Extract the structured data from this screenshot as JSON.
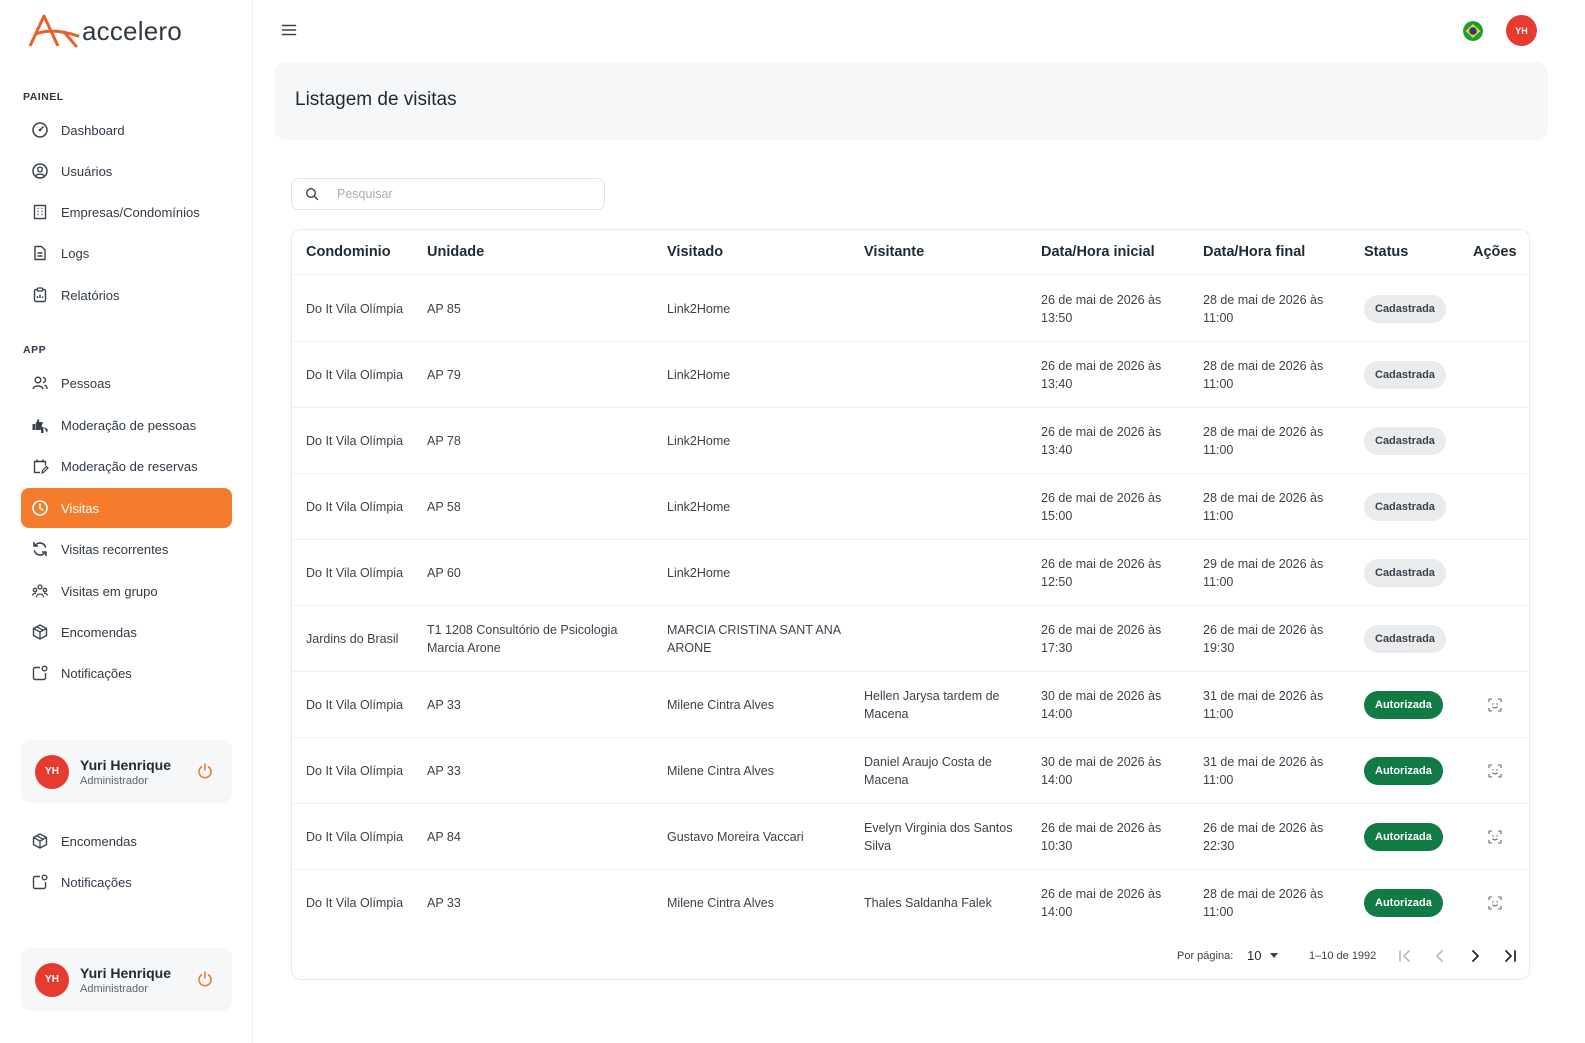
{
  "brand": {
    "name": "accelero",
    "accent": "#f47c2c"
  },
  "sidebar": {
    "sections": [
      {
        "label": "PAINEL",
        "items": [
          {
            "label": "Dashboard",
            "icon": "dashboard-icon"
          },
          {
            "label": "Usuários",
            "icon": "user-circle-icon"
          },
          {
            "label": "Empresas/Condomínios",
            "icon": "building-icon"
          },
          {
            "label": "Logs",
            "icon": "file-icon"
          },
          {
            "label": "Relatórios",
            "icon": "clipboard-icon"
          }
        ]
      },
      {
        "label": "APP",
        "items": [
          {
            "label": "Pessoas",
            "icon": "people-icon"
          },
          {
            "label": "Moderação de pessoas",
            "icon": "thumbs-icon"
          },
          {
            "label": "Moderação de reservas",
            "icon": "calendar-edit-icon"
          },
          {
            "label": "Visitas",
            "icon": "clock-icon",
            "active": true
          },
          {
            "label": "Visitas recorrentes",
            "icon": "refresh-icon"
          },
          {
            "label": "Visitas em grupo",
            "icon": "group-icon"
          },
          {
            "label": "Encomendas",
            "icon": "package-icon"
          },
          {
            "label": "Notificações",
            "icon": "notification-icon"
          }
        ]
      }
    ],
    "extra_items": [
      {
        "label": "Encomendas",
        "icon": "package-icon"
      },
      {
        "label": "Notificações",
        "icon": "notification-icon"
      }
    ],
    "user": {
      "initials": "YH",
      "name": "Yuri Henrique",
      "role": "Administrador"
    }
  },
  "header": {
    "avatar_initials": "YH",
    "language_flag": "brazil-flag-icon"
  },
  "page": {
    "title": "Listagem de visitas"
  },
  "search": {
    "placeholder": "Pesquisar",
    "value": ""
  },
  "table": {
    "columns": [
      "Condominio",
      "Unidade",
      "Visitado",
      "Visitante",
      "Data/Hora inicial",
      "Data/Hora final",
      "Status",
      "Ações"
    ],
    "rows": [
      {
        "condominio": "Do It Vila Olímpia",
        "unidade": "AP 85",
        "visitado": "Link2Home",
        "visitante": "",
        "inicio": "26 de mai de 2026 às 13:50",
        "fim": "28 de mai de 2026 às 11:00",
        "status": "Cadastrada",
        "acao": false
      },
      {
        "condominio": "Do It Vila Olímpia",
        "unidade": "AP 79",
        "visitado": "Link2Home",
        "visitante": "",
        "inicio": "26 de mai de 2026 às 13:40",
        "fim": "28 de mai de 2026 às 11:00",
        "status": "Cadastrada",
        "acao": false
      },
      {
        "condominio": "Do It Vila Olímpia",
        "unidade": "AP 78",
        "visitado": "Link2Home",
        "visitante": "",
        "inicio": "26 de mai de 2026 às 13:40",
        "fim": "28 de mai de 2026 às 11:00",
        "status": "Cadastrada",
        "acao": false
      },
      {
        "condominio": "Do It Vila Olímpia",
        "unidade": "AP 58",
        "visitado": "Link2Home",
        "visitante": "",
        "inicio": "26 de mai de 2026 às 15:00",
        "fim": "28 de mai de 2026 às 11:00",
        "status": "Cadastrada",
        "acao": false
      },
      {
        "condominio": "Do It Vila Olímpia",
        "unidade": "AP 60",
        "visitado": "Link2Home",
        "visitante": "",
        "inicio": "26 de mai de 2026 às 12:50",
        "fim": "29 de mai de 2026 às 11:00",
        "status": "Cadastrada",
        "acao": false
      },
      {
        "condominio": "Jardins do Brasil",
        "unidade": "T1 1208 Consultório de Psicologia Marcia Arone",
        "visitado": "MARCIA CRISTINA SANT ANA ARONE",
        "visitante": "",
        "inicio": "26 de mai de 2026 às 17:30",
        "fim": "26 de mai de 2026 às 19:30",
        "status": "Cadastrada",
        "acao": false
      },
      {
        "condominio": "Do It Vila Olímpia",
        "unidade": "AP 33",
        "visitado": "Milene Cintra Alves",
        "visitante": "Hellen Jarysa tardem de Macena",
        "inicio": "30 de mai de 2026 às 14:00",
        "fim": "31 de mai de 2026 às 11:00",
        "status": "Autorizada",
        "acao": true
      },
      {
        "condominio": "Do It Vila Olímpia",
        "unidade": "AP 33",
        "visitado": "Milene Cintra Alves",
        "visitante": "Daniel Araujo Costa de Macena",
        "inicio": "30 de mai de 2026 às 14:00",
        "fim": "31 de mai de 2026 às 11:00",
        "status": "Autorizada",
        "acao": true
      },
      {
        "condominio": "Do It Vila Olímpia",
        "unidade": "AP 84",
        "visitado": "Gustavo Moreira Vaccari",
        "visitante": "Evelyn Virginia dos Santos Silva",
        "inicio": "26 de mai de 2026 às 10:30",
        "fim": "26 de mai de 2026 às 22:30",
        "status": "Autorizada",
        "acao": true
      },
      {
        "condominio": "Do It Vila Olímpia",
        "unidade": "AP 33",
        "visitado": "Milene Cintra Alves",
        "visitante": "Thales Saldanha Falek",
        "inicio": "26 de mai de 2026 às 14:00",
        "fim": "28 de mai de 2026 às 11:00",
        "status": "Autorizada",
        "acao": true
      }
    ]
  },
  "pagination": {
    "per_page_label": "Por página:",
    "per_page": "10",
    "range": "1–10 de 1992"
  },
  "colors": {
    "active_nav": "#f47c2c",
    "authorized": "#127a45",
    "registered": "#e9ebed",
    "avatar": "#e63b2e"
  }
}
